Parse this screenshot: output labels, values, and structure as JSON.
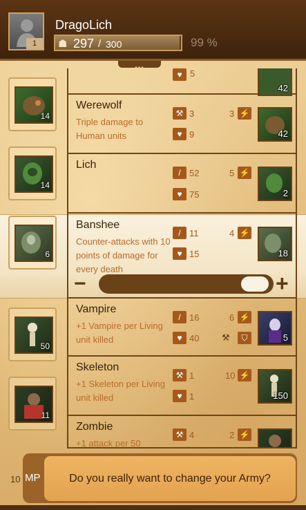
{
  "player": {
    "name": "DragoLich",
    "level": "1",
    "hp_current": "297",
    "hp_separator": "/",
    "hp_max": "300",
    "hp_percent": "99 %",
    "hp_fill_fraction": 0.99
  },
  "handle": "•••",
  "left_avatars": [
    {
      "count": "14",
      "icon": "werewolf"
    },
    {
      "count": "14",
      "icon": "lich"
    },
    {
      "count": "6",
      "icon": "banshee"
    },
    {
      "count": "50",
      "icon": "skeleton"
    },
    {
      "count": "11",
      "icon": "zombie"
    }
  ],
  "partial_top_row": {
    "stat": "5",
    "count": "42"
  },
  "units": [
    {
      "name": "Werewolf",
      "description": "Triple damage to Human units",
      "attack": "3",
      "attack_icon": "axe-icon",
      "health": "9",
      "speed": "3",
      "count": "42"
    },
    {
      "name": "Lich",
      "description": "",
      "attack": "52",
      "attack_icon": "wand-icon",
      "health": "75",
      "speed": "5",
      "count": "2"
    },
    {
      "name": "Banshee",
      "description": "Counter-attacks with 10 points of damage for every death",
      "attack": "11",
      "attack_icon": "wand-icon",
      "health": "15",
      "speed": "4",
      "count": "18"
    },
    {
      "name": "Vampire",
      "description": "+1 Vampire per Living unit killed",
      "attack": "16",
      "attack_icon": "wand-icon",
      "health": "40",
      "speed": "6",
      "count": "5"
    },
    {
      "name": "Skeleton",
      "description": "+1 Skeleton per Living unit killed",
      "attack": "1",
      "attack_icon": "axe-icon",
      "health": "1",
      "speed": "10",
      "count": "150"
    },
    {
      "name": "Zombie",
      "description": "+1 attack per 50",
      "attack": "4",
      "attack_icon": "axe-icon",
      "health": "",
      "speed": "2",
      "count": ""
    }
  ],
  "slider": {
    "minus": "−",
    "plus": "+",
    "value_fraction": 0.98
  },
  "footer": {
    "mp_count": "10",
    "mp_label": "MP",
    "confirm_text": "Do you really want to change your Army?"
  },
  "colors": {
    "header": "#4a2a0f",
    "accent": "#a4591b",
    "button": "#e8aa55"
  }
}
